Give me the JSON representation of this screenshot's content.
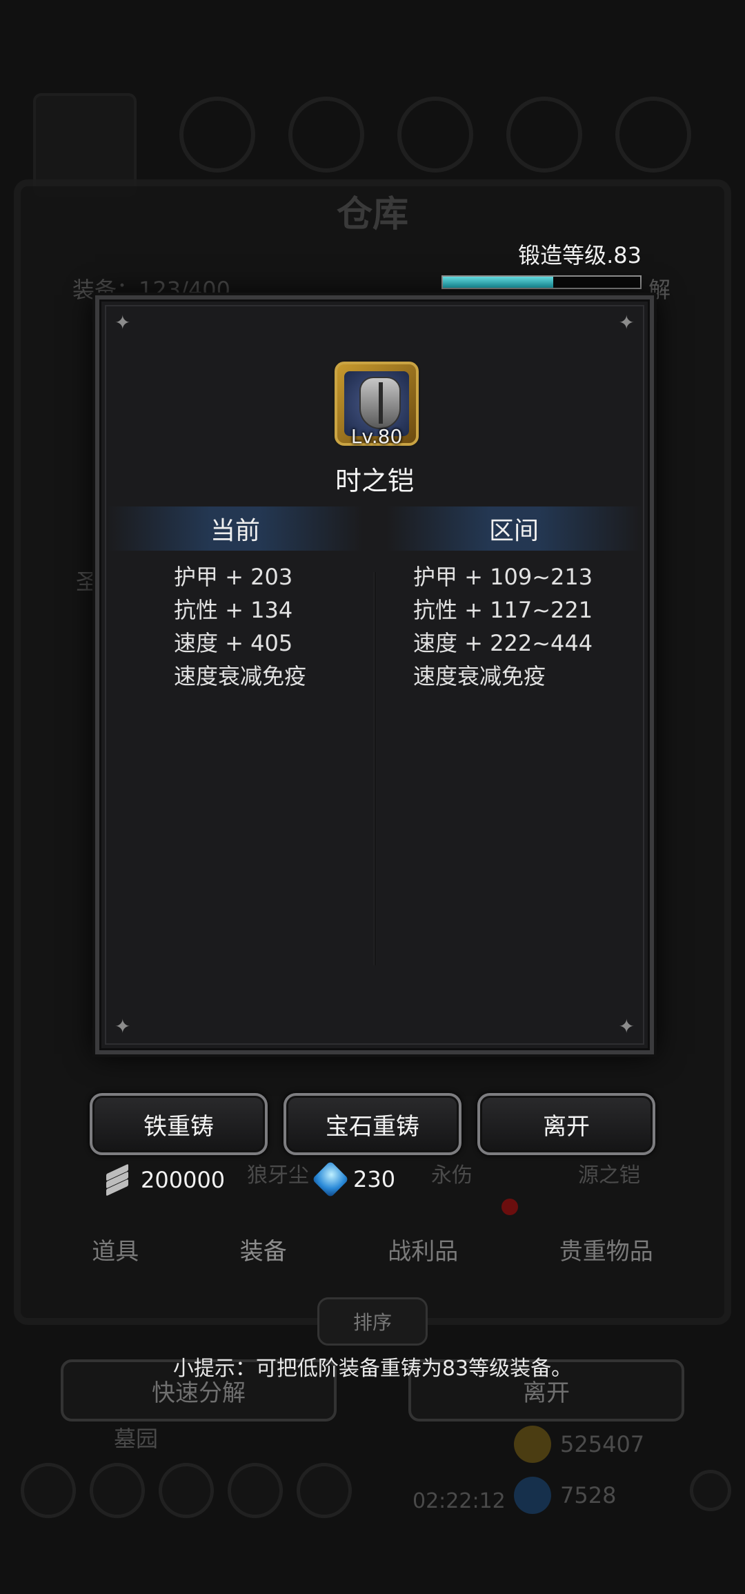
{
  "background": {
    "title": "仓库",
    "equip_count": "装备：123/400",
    "tabs": [
      "道具",
      "装备",
      "战利品",
      "贵重物品"
    ],
    "sort_label": "排序",
    "quick_decompose_label": "快速分解",
    "leave_label": "离开",
    "item_labels": [
      "狼牙尘",
      "永伤",
      "源之铠"
    ],
    "location_label": "墓园",
    "timer": "02:22:12",
    "gold_amount": "525407",
    "gem_amount": "7528",
    "side_label_left": "圣",
    "decompose_label": "解"
  },
  "forge": {
    "label": "锻造等级.83",
    "progress": 0.56
  },
  "item": {
    "level": "Lv.80",
    "name": "时之铠"
  },
  "stats": {
    "current_header": "当前",
    "range_header": "区间",
    "current": [
      "护甲 + 203",
      "抗性 + 134",
      "速度 + 405",
      "速度衰减免疫"
    ],
    "range": [
      "护甲 + 109~213",
      "抗性 + 117~221",
      "速度 + 222~444",
      "速度衰减免疫"
    ]
  },
  "actions": {
    "iron_reforge": "铁重铸",
    "gem_reforge": "宝石重铸",
    "leave": "离开"
  },
  "costs": {
    "iron": "200000",
    "gem": "230"
  },
  "hint": "小提示：可把低阶装备重铸为83等级装备。",
  "colors": {
    "forge_bar": "#3fd3dd",
    "item_frame": "#c79a2e",
    "header_band": "#28466e"
  }
}
